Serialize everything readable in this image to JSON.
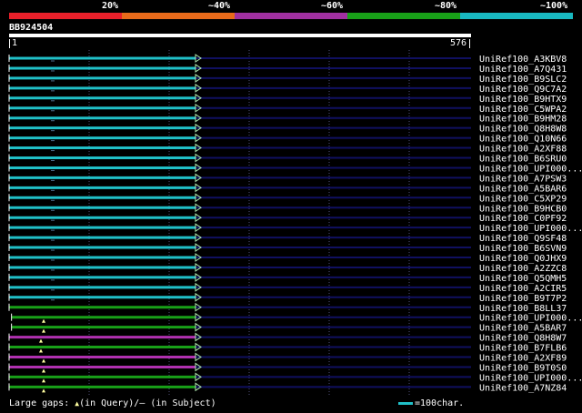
{
  "legend": {
    "labels": [
      "20%",
      "~40%",
      "~60%",
      "~80%",
      "~100%"
    ],
    "colors": [
      "#e8202a",
      "#e86a1a",
      "#a030a0",
      "#18a018",
      "#18b8c0"
    ]
  },
  "query": {
    "id": "BB924504",
    "start": "1",
    "end": "576",
    "length": 576
  },
  "hits": [
    {
      "name": "UniRef100_A3KBV8",
      "color": "cyan",
      "start": 1,
      "end": 576
    },
    {
      "name": "UniRef100_A7Q431",
      "color": "cyan",
      "start": 1,
      "end": 576
    },
    {
      "name": "UniRef100_B9SLC2",
      "color": "cyan",
      "start": 1,
      "end": 576
    },
    {
      "name": "UniRef100_Q9C7A2",
      "color": "cyan",
      "start": 1,
      "end": 576
    },
    {
      "name": "UniRef100_B9HTX9",
      "color": "cyan",
      "start": 1,
      "end": 576
    },
    {
      "name": "UniRef100_C5WPA2",
      "color": "cyan",
      "start": 1,
      "end": 576
    },
    {
      "name": "UniRef100_B9HM28",
      "color": "cyan",
      "start": 1,
      "end": 576
    },
    {
      "name": "UniRef100_Q8H8W8",
      "color": "cyan",
      "start": 1,
      "end": 576
    },
    {
      "name": "UniRef100_Q10N66",
      "color": "cyan",
      "start": 1,
      "end": 576
    },
    {
      "name": "UniRef100_A2XF88",
      "color": "cyan",
      "start": 1,
      "end": 576
    },
    {
      "name": "UniRef100_B6SRU0",
      "color": "cyan",
      "start": 1,
      "end": 576
    },
    {
      "name": "UniRef100_UPI000...",
      "color": "cyan",
      "start": 1,
      "end": 576
    },
    {
      "name": "UniRef100_A7PSW3",
      "color": "cyan",
      "start": 1,
      "end": 576
    },
    {
      "name": "UniRef100_A5BAR6",
      "color": "cyan",
      "start": 1,
      "end": 576
    },
    {
      "name": "UniRef100_C5XP29",
      "color": "cyan",
      "start": 1,
      "end": 576
    },
    {
      "name": "UniRef100_B9HCB0",
      "color": "cyan",
      "start": 1,
      "end": 576
    },
    {
      "name": "UniRef100_C0PF92",
      "color": "cyan",
      "start": 1,
      "end": 576
    },
    {
      "name": "UniRef100_UPI000...",
      "color": "cyan",
      "start": 1,
      "end": 576
    },
    {
      "name": "UniRef100_Q9SF48",
      "color": "cyan",
      "start": 1,
      "end": 576
    },
    {
      "name": "UniRef100_B6SVN9",
      "color": "cyan",
      "start": 1,
      "end": 576
    },
    {
      "name": "UniRef100_Q0JHX9",
      "color": "cyan",
      "start": 1,
      "end": 576
    },
    {
      "name": "UniRef100_A2ZZC8",
      "color": "cyan",
      "start": 1,
      "end": 576
    },
    {
      "name": "UniRef100_Q5QMH5",
      "color": "cyan",
      "start": 1,
      "end": 576
    },
    {
      "name": "UniRef100_A2CIR5",
      "color": "cyan",
      "start": 1,
      "end": 576
    },
    {
      "name": "UniRef100_B9T7P2",
      "color": "cyan",
      "start": 1,
      "end": 576
    },
    {
      "name": "UniRef100_B8LL37",
      "color": "green",
      "start": 1,
      "end": 576
    },
    {
      "name": "UniRef100_UPI000...",
      "color": "green",
      "start": 4,
      "end": 576
    },
    {
      "name": "UniRef100_A5BAR7",
      "color": "green",
      "start": 4,
      "end": 576
    },
    {
      "name": "UniRef100_Q8H8W7",
      "color": "magenta",
      "start": 1,
      "end": 576
    },
    {
      "name": "UniRef100_B7FLB6",
      "color": "green",
      "start": 1,
      "end": 576
    },
    {
      "name": "UniRef100_A2XF89",
      "color": "magenta",
      "start": 1,
      "end": 576
    },
    {
      "name": "UniRef100_B9T0S0",
      "color": "magenta",
      "start": 1,
      "end": 576
    },
    {
      "name": "UniRef100_UPI000...",
      "color": "green",
      "start": 1,
      "end": 576
    },
    {
      "name": "UniRef100_A7NZ84",
      "color": "green",
      "start": 1,
      "end": 576
    }
  ],
  "footer": {
    "gaps_label": "Large gaps: ",
    "query_gap_glyph": "▲",
    "query_gap_text": "(in Query)/",
    "subject_gap_glyph": "–",
    "subject_gap_text": " (in Subject)",
    "scale_text": "=100char."
  },
  "colors": {
    "cyan": "#20c0c8",
    "green": "#18a018",
    "magenta": "#b030b0",
    "navy": "#101060",
    "gridline": "#50507a",
    "arrow": "#b0e8b0",
    "gap_marker": "#ffffa0"
  }
}
